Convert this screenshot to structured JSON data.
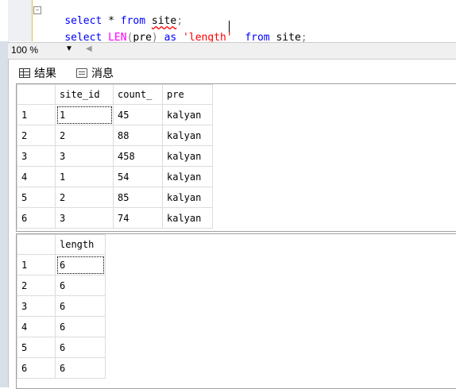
{
  "editor": {
    "line1": {
      "kw1": "select",
      "rest1": " * ",
      "kw2": "from",
      "sp": " ",
      "table": "site",
      "end": ";"
    },
    "line2": {
      "kw1": "select",
      "sp1": " ",
      "fn": "LEN",
      "p1": "(",
      "col": "pre",
      "p2": ")",
      "sp2": " ",
      "kw2": "as",
      "sp3": " ",
      "str": "'length'",
      "sp4": "  ",
      "kw3": "from",
      "sp5": " ",
      "table": "site",
      "end": ";"
    },
    "collapse_symbol": "−"
  },
  "zoom": {
    "value": "100 %",
    "arrow": "▼",
    "scroll": "◀"
  },
  "tabs": [
    {
      "label": "结果"
    },
    {
      "label": "消息"
    }
  ],
  "results1": {
    "headers": [
      "site_id",
      "count_",
      "pre"
    ],
    "rows": [
      [
        "1",
        "1",
        "45",
        "kalyan"
      ],
      [
        "2",
        "2",
        "88",
        "kalyan"
      ],
      [
        "3",
        "3",
        "458",
        "kalyan"
      ],
      [
        "4",
        "1",
        "54",
        "kalyan"
      ],
      [
        "5",
        "2",
        "85",
        "kalyan"
      ],
      [
        "6",
        "3",
        "74",
        "kalyan"
      ]
    ]
  },
  "results2": {
    "headers": [
      "length"
    ],
    "rows": [
      [
        "1",
        "6"
      ],
      [
        "2",
        "6"
      ],
      [
        "3",
        "6"
      ],
      [
        "4",
        "6"
      ],
      [
        "5",
        "6"
      ],
      [
        "6",
        "6"
      ]
    ]
  }
}
